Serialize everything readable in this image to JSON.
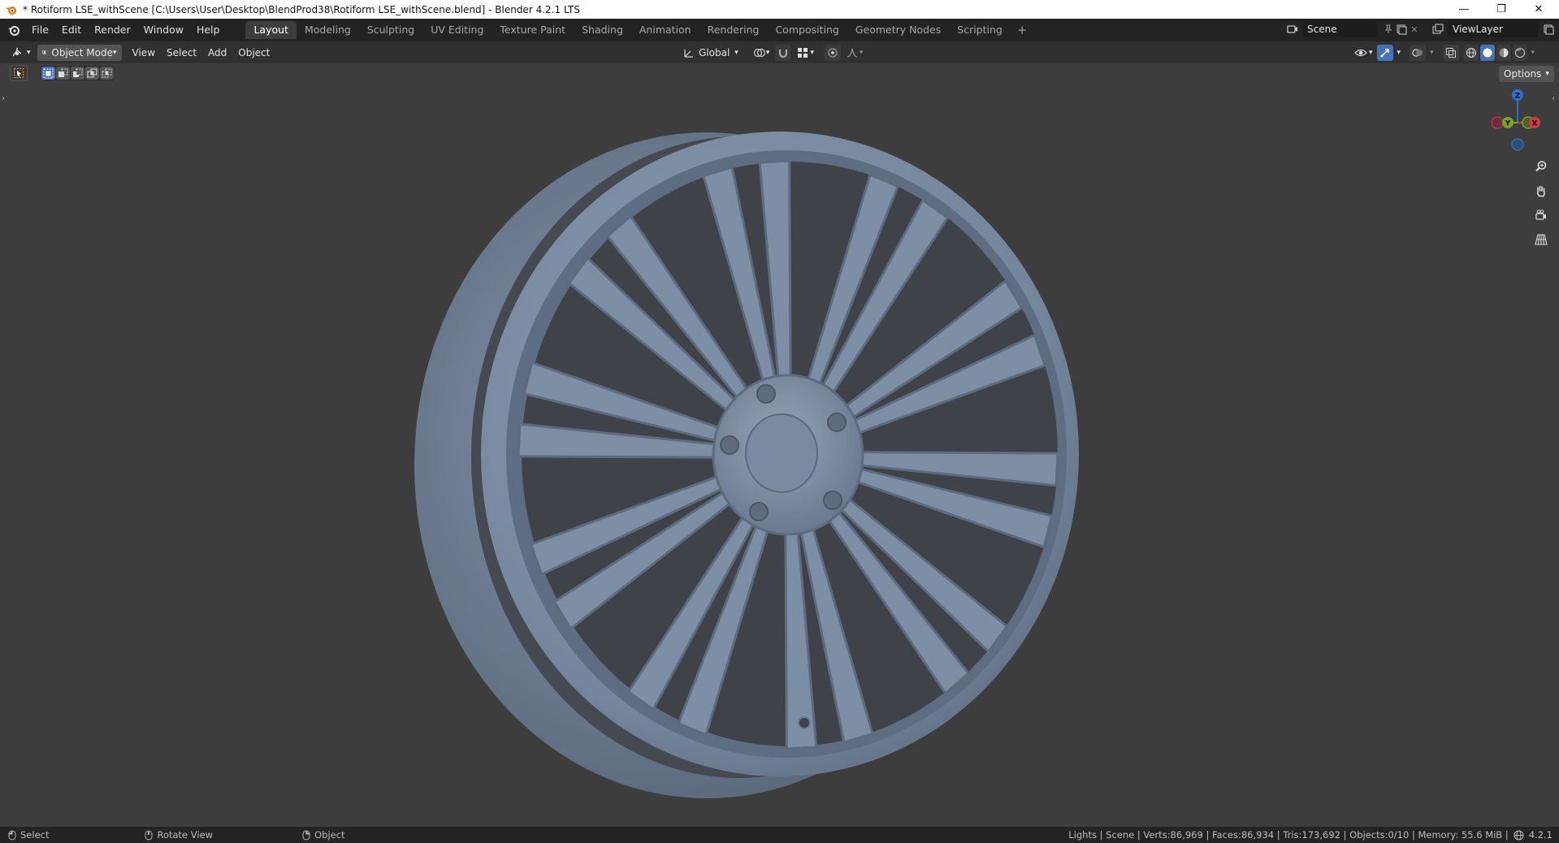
{
  "window": {
    "title": "* Rotiform LSE_withScene [C:\\Users\\User\\Desktop\\BlendProd38\\Rotiform LSE_withScene.blend] - Blender 4.2.1 LTS",
    "minimize": "—",
    "maximize": "❐",
    "close": "✕"
  },
  "menu": [
    "File",
    "Edit",
    "Render",
    "Window",
    "Help"
  ],
  "workspaces": [
    "Layout",
    "Modeling",
    "Sculpting",
    "UV Editing",
    "Texture Paint",
    "Shading",
    "Animation",
    "Rendering",
    "Compositing",
    "Geometry Nodes",
    "Scripting"
  ],
  "active_workspace": "Layout",
  "add_workspace": "+",
  "scene": {
    "name": "Scene",
    "view_layer": "ViewLayer"
  },
  "header": {
    "mode": "Object Mode",
    "view_menu": [
      "View",
      "Select",
      "Add",
      "Object"
    ],
    "orientation": "Global",
    "options": "Options"
  },
  "status": {
    "left": [
      "Select",
      "Rotate View",
      "Object"
    ],
    "right": "Lights | Scene | Verts:86,969 | Faces:86,934 | Tris:173,692 | Objects:0/10 | Memory: 55.6 MiB |",
    "version": "4.2.1"
  },
  "gizmo": {
    "z": "Z",
    "y": "Y",
    "x": "X"
  },
  "colors": {
    "accent": "#4772b3",
    "wheel": "#7b8aa0",
    "background": "#3d3d3d"
  }
}
